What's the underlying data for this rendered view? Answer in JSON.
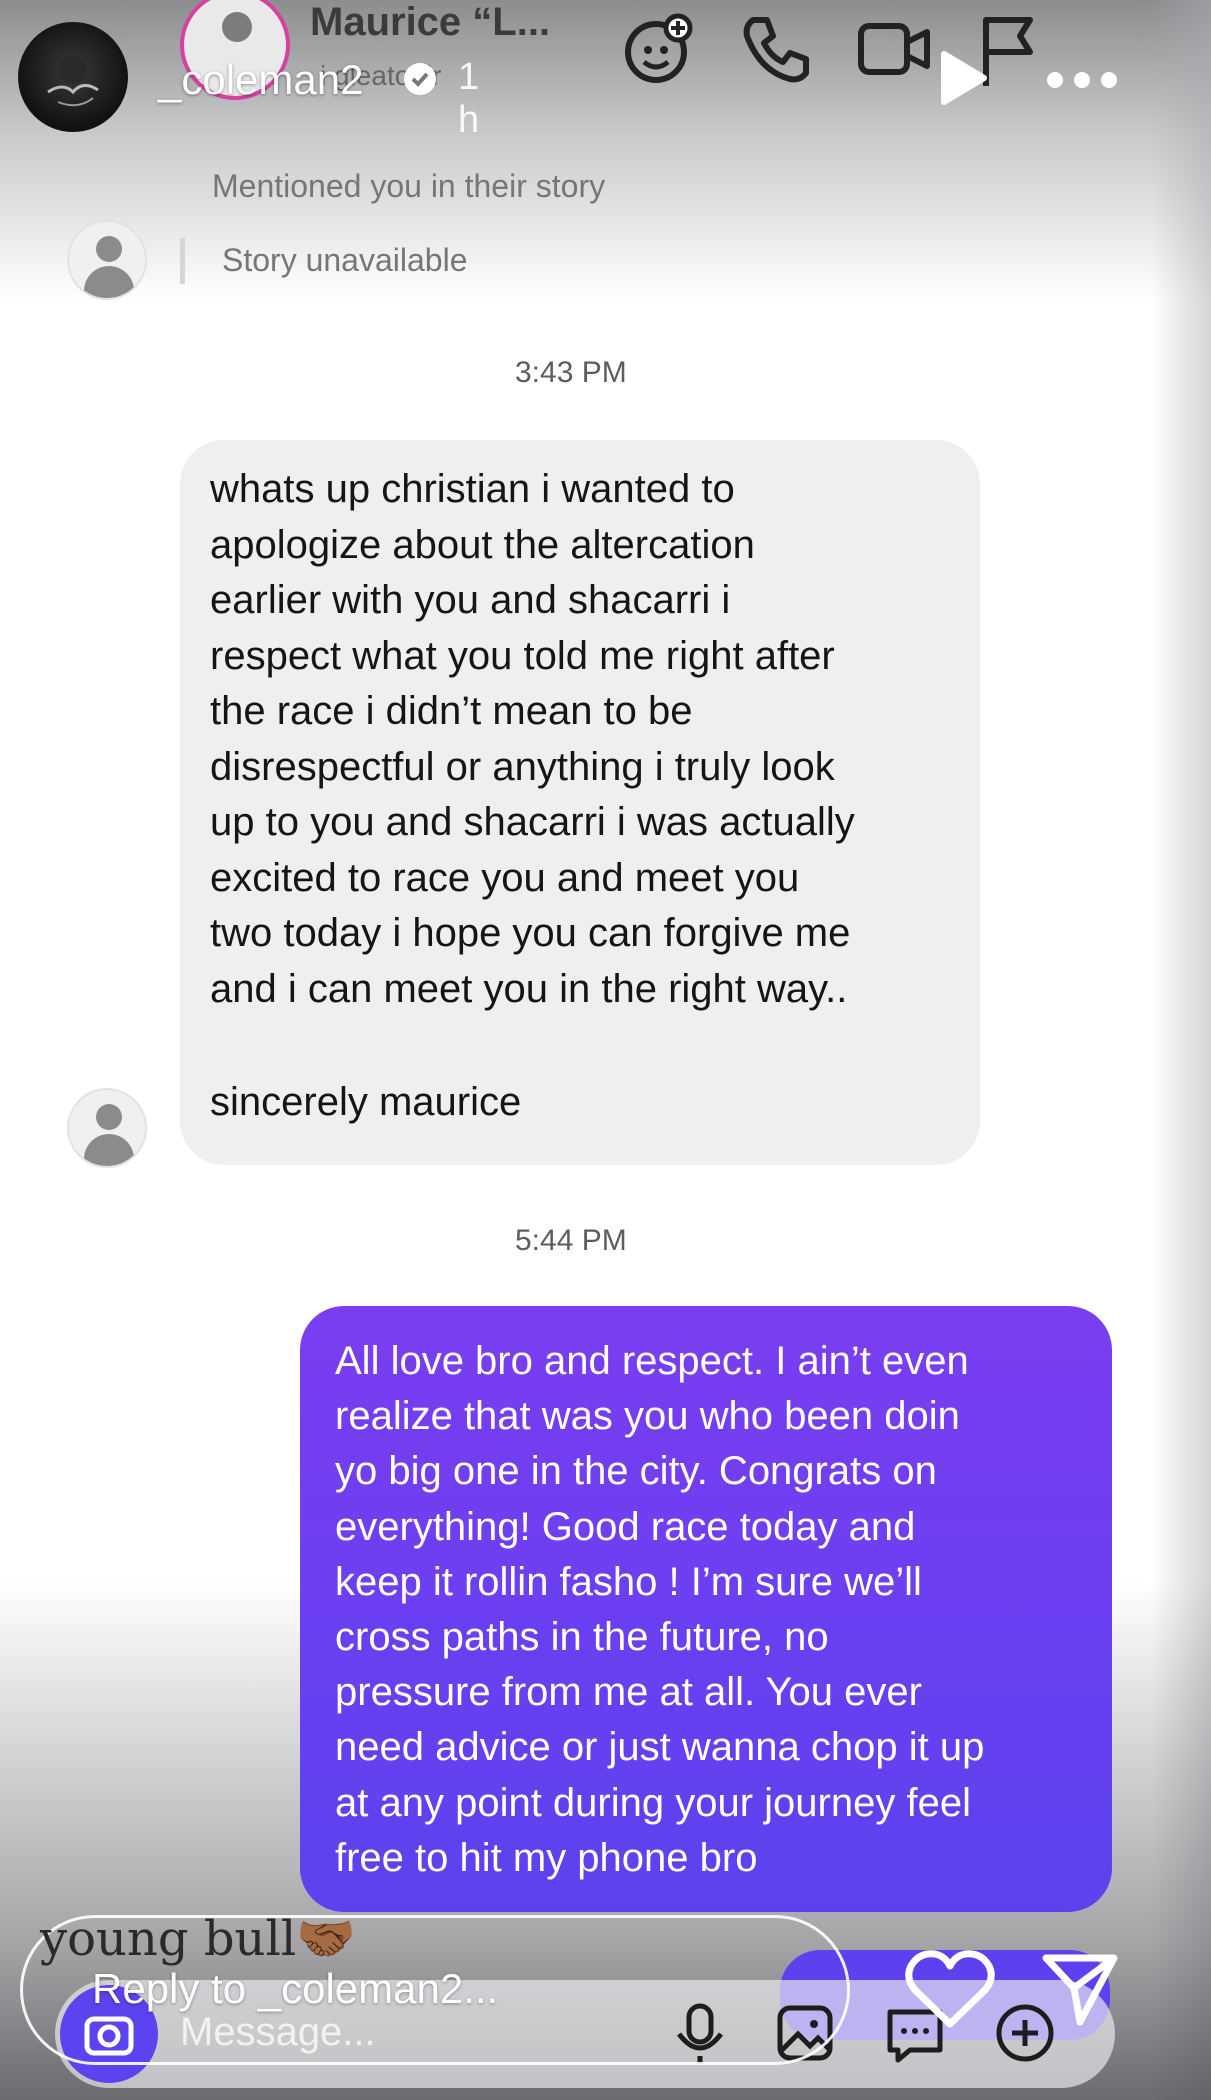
{
  "story": {
    "username": "_coleman2",
    "time": "1 h",
    "caption": "young bull",
    "caption_emoji": "🤝🏾",
    "reply_placeholder": "Reply to _coleman2..."
  },
  "dm": {
    "title": "Maurice “L...",
    "subtitle": "i gleatonjr",
    "mention_text": "Mentioned you in their story",
    "story_unavailable": "Story unavailable",
    "composer_placeholder": "Message..."
  },
  "messages": [
    {
      "time": "3:43 PM",
      "direction": "incoming",
      "lines": [
        "whats up christian i wanted to",
        "apologize about the altercation",
        "earlier with you and shacarri i",
        "respect what you told me right after",
        "the race i didn’t mean to be",
        "disrespectful or anything i truly look",
        "up to you and shacarri i was actually",
        "excited to race you and meet you",
        "two today i hope you can forgive me",
        "and i can meet you in the right way.."
      ],
      "signature": "sincerely maurice"
    },
    {
      "time": "5:44 PM",
      "direction": "outgoing",
      "lines": [
        "All love bro and respect. I ain’t even",
        "realize that was you who been doin",
        "yo big one in the city. Congrats on",
        "everything! Good race today and",
        "keep it rollin fasho ! I’m sure we’ll",
        "cross paths in the future, no",
        "pressure from me at all. You ever",
        "need advice or just wanna chop it up",
        "at any point during your journey feel",
        "free to hit my phone bro"
      ]
    }
  ],
  "colors": {
    "outgoing_bubble": "#6b3ff1",
    "incoming_bubble": "#efeff0",
    "dm_story_ring": "#d6409f"
  },
  "icons": [
    "video-chat-effects-icon",
    "phone-icon",
    "video-call-icon",
    "flag-icon",
    "play-icon",
    "more-icon",
    "verified-icon",
    "camera-icon",
    "microphone-icon",
    "gallery-icon",
    "sticker-icon",
    "add-icon",
    "heart-icon",
    "send-icon"
  ]
}
